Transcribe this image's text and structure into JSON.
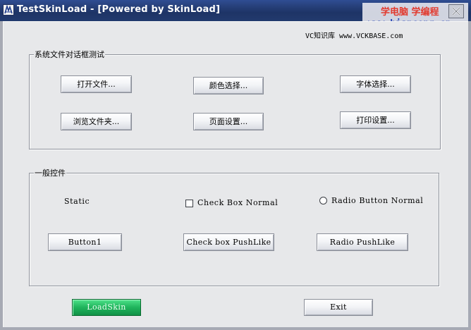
{
  "window": {
    "title": "TestSkinLoad - [Powered by SkinLoad]",
    "watermark_line1": "学电脑 学编程",
    "watermark_line2": "www.bianceng.cn"
  },
  "site_label": "VC知识库 www.VCKBASE.com",
  "file_dialog_group": {
    "label": "系统文件对话框测试",
    "buttons": {
      "open_file": "打开文件...",
      "color_select": "颜色选择...",
      "font_select": "字体选择...",
      "browse_folder": "浏览文件夹...",
      "page_setup": "页面设置...",
      "print_setup": "打印设置..."
    }
  },
  "controls_group": {
    "label": "一般控件",
    "static_text": "Static",
    "checkbox_label": "Check Box Normal",
    "checkbox_checked": false,
    "radio_label": "Radio Button Normal",
    "radio_selected": false,
    "button1": "Button1",
    "check_pushlike": "Check box PushLike",
    "radio_pushlike": "Radio  PushLike"
  },
  "footer": {
    "loadskin": "LoadSkin",
    "exit": "Exit"
  },
  "colors": {
    "titlebar": "#27407a",
    "client_bg": "#e7e8ea",
    "loadskin_green": "#1fb45c"
  }
}
